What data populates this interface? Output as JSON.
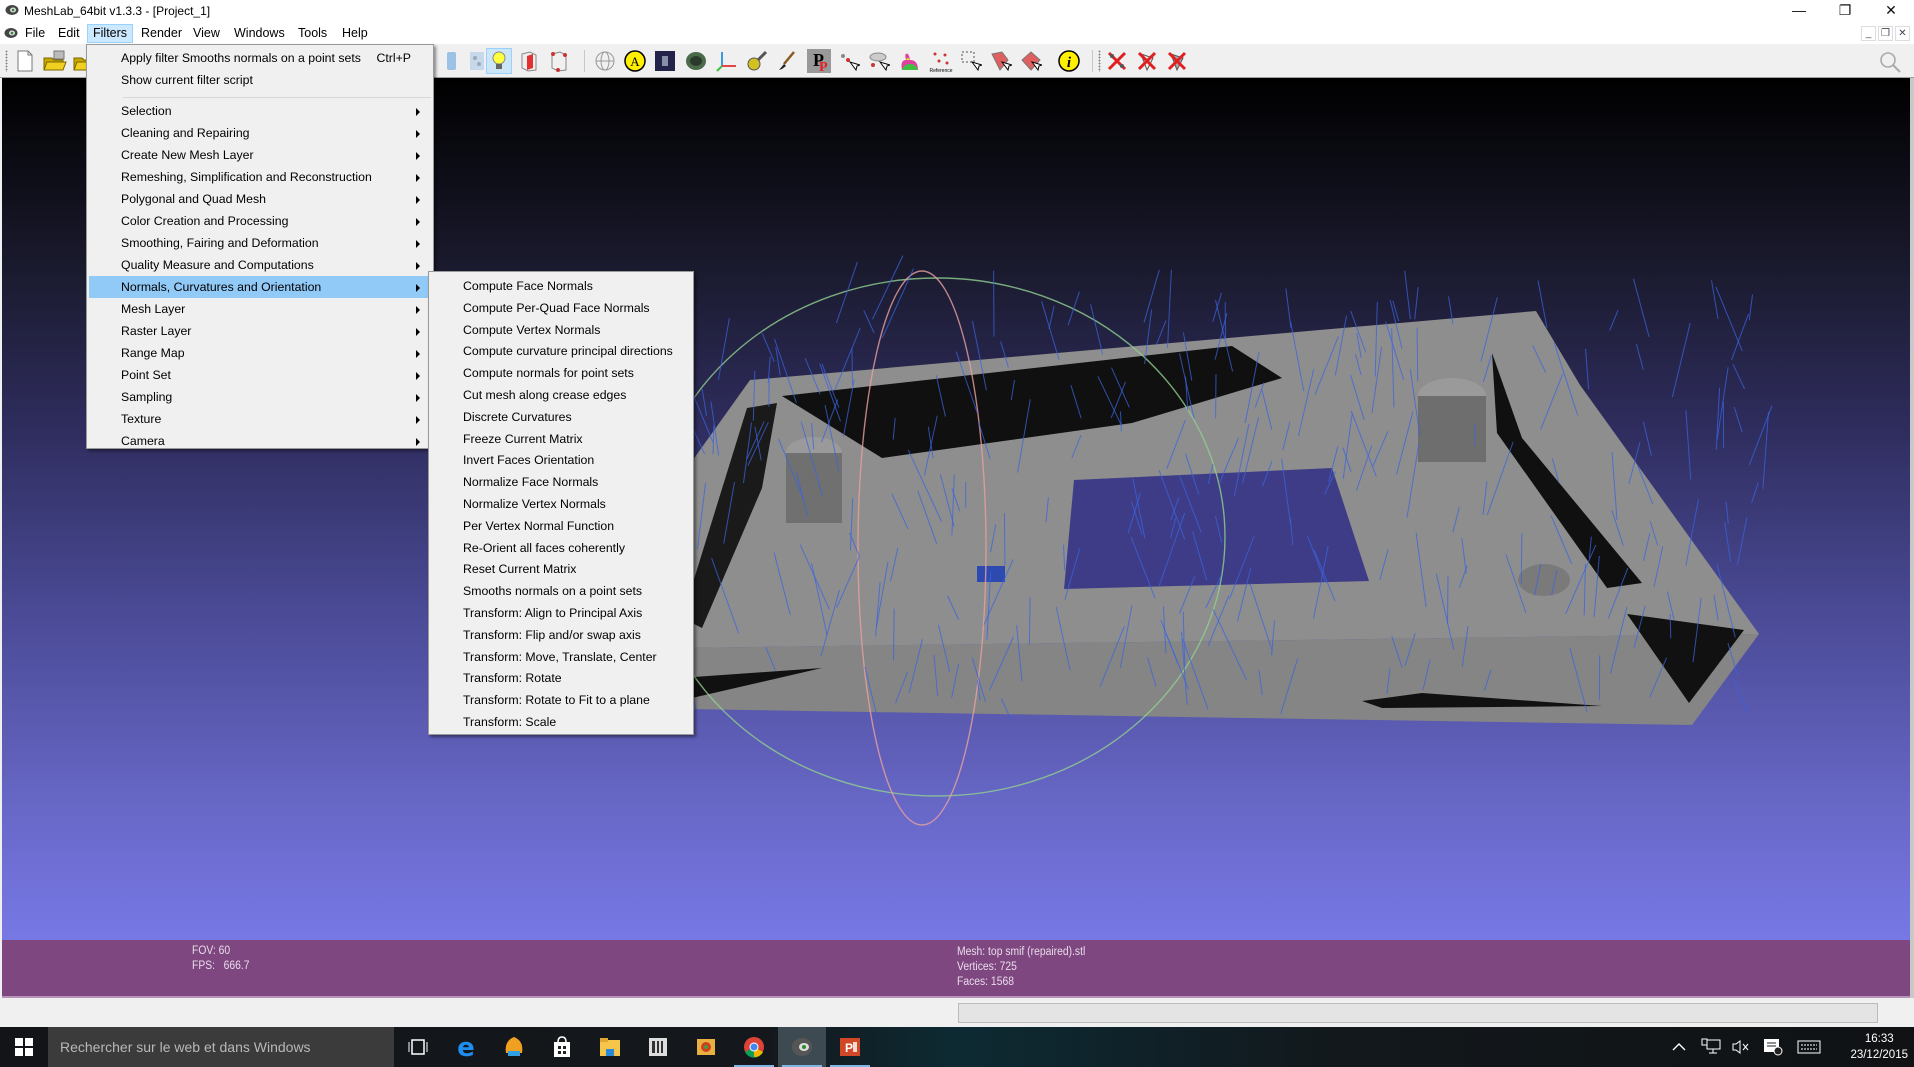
{
  "window": {
    "title": "MeshLab_64bit v1.3.3 - [Project_1]",
    "controls": {
      "minimize": "—",
      "restore": "❐",
      "close": "✕"
    },
    "mdi_controls": {
      "minimize": "_",
      "restore": "❐",
      "close": "✕"
    }
  },
  "menubar": {
    "items": [
      {
        "label": "File"
      },
      {
        "label": "Edit"
      },
      {
        "label": "Filters",
        "active": true
      },
      {
        "label": "Render"
      },
      {
        "label": "View"
      },
      {
        "label": "Windows"
      },
      {
        "label": "Tools"
      },
      {
        "label": "Help"
      }
    ]
  },
  "toolbar": {
    "icons": [
      "new-project-icon",
      "open-project-icon",
      "import-mesh-icon",
      "box-icon",
      "texture-icon",
      "light-bulb-icon",
      "backface-icon",
      "selected-faces-icon",
      "trackball-icon",
      "annotation-a-icon",
      "raster-icon",
      "mesh-icon",
      "axis-icon",
      "measure-tape-icon",
      "paint-brush-icon",
      "pick-points-icon",
      "select-vertices-icon",
      "select-connected-icon",
      "color-bunny-icon",
      "reference-icon",
      "select-area-icon",
      "delete-faces-icon",
      "edit-faces-icon",
      "info-icon",
      "delete-selected-vertices-icon",
      "delete-selected-faces-icon",
      "delete-selected-all-icon"
    ],
    "light_checked": true,
    "reference_label": "Reference"
  },
  "filters_menu": {
    "top_items": [
      {
        "label": "Apply filter Smooths normals on a point sets",
        "shortcut": "Ctrl+P"
      },
      {
        "label": "Show current filter script"
      }
    ],
    "submenus": [
      {
        "label": "Selection"
      },
      {
        "label": "Cleaning and Repairing"
      },
      {
        "label": "Create New Mesh Layer"
      },
      {
        "label": "Remeshing, Simplification and Reconstruction"
      },
      {
        "label": "Polygonal and Quad Mesh"
      },
      {
        "label": "Color Creation and Processing"
      },
      {
        "label": "Smoothing, Fairing and Deformation"
      },
      {
        "label": "Quality Measure and Computations"
      },
      {
        "label": "Normals, Curvatures and Orientation",
        "highlighted": true
      },
      {
        "label": "Mesh Layer"
      },
      {
        "label": "Raster Layer"
      },
      {
        "label": "Range Map"
      },
      {
        "label": "Point Set"
      },
      {
        "label": "Sampling"
      },
      {
        "label": "Texture"
      },
      {
        "label": "Camera"
      }
    ]
  },
  "normals_submenu": {
    "items": [
      "Compute Face Normals",
      "Compute Per-Quad Face Normals",
      "Compute Vertex Normals",
      "Compute curvature principal directions",
      "Compute normals for point sets",
      "Cut mesh along crease edges",
      "Discrete Curvatures",
      "Freeze Current Matrix",
      "Invert Faces Orientation",
      "Normalize Face Normals",
      "Normalize Vertex Normals",
      "Per Vertex Normal Function",
      "Re-Orient all faces coherently",
      "Reset Current Matrix",
      "Smooths normals on a point sets",
      "Transform: Align to Principal Axis",
      "Transform: Flip and/or swap axis",
      "Transform: Move, Translate, Center",
      "Transform: Rotate",
      "Transform: Rotate to Fit to a plane",
      "Transform: Scale"
    ]
  },
  "info": {
    "fov": "FOV: 60",
    "fps": "FPS:   666.7",
    "mesh": "Mesh: top smif (repaired).stl",
    "vertices": "Vertices: 725",
    "faces": "Faces: 1568"
  },
  "colors": {
    "info_bar": "#7f4780",
    "menu_highlight": "#91c9f7",
    "mesh_gray": "#8c8c8c",
    "normals_blue": "#3a64e0"
  },
  "taskbar": {
    "search_placeholder": "Rechercher sur le web et dans Windows",
    "apps": [
      "task-view-icon",
      "edge-icon",
      "shell-app-icon",
      "store-icon",
      "file-explorer-icon",
      "office-lens-icon",
      "photo-app-icon",
      "chrome-icon",
      "meshlab-icon",
      "powerpoint-icon"
    ],
    "time": "16:33",
    "date": "23/12/2015"
  }
}
